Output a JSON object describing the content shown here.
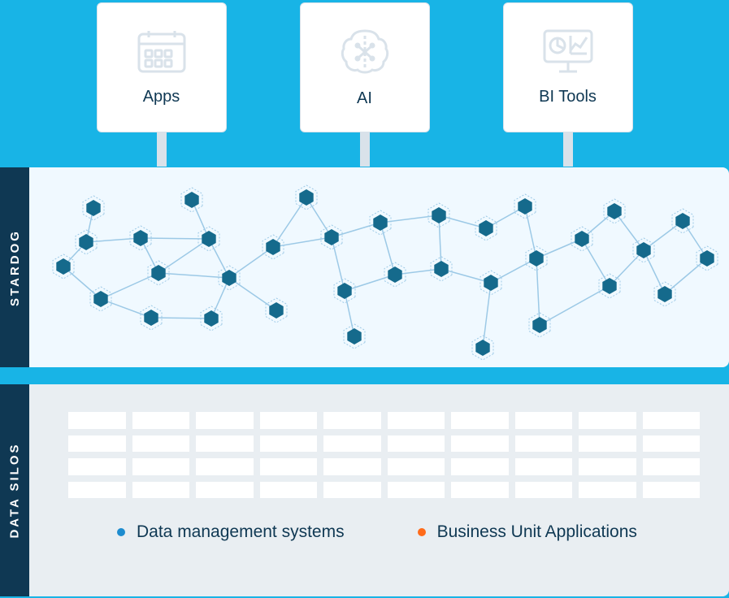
{
  "cards": {
    "apps": "Apps",
    "ai": "AI",
    "bi": "BI Tools"
  },
  "bands": {
    "stardog": "STARDOG",
    "silos": "DATA SILOS"
  },
  "legend": {
    "dms": "Data management systems",
    "bua": "Business Unit Applications"
  },
  "colors": {
    "bg": "#18b4e6",
    "dark": "#0f3853",
    "accent_blue": "#1d8ccf",
    "accent_orange": "#ff6b1a"
  },
  "graph_nodes": [
    [
      28,
      110
    ],
    [
      56,
      80
    ],
    [
      65,
      38
    ],
    [
      74,
      150
    ],
    [
      123,
      75
    ],
    [
      136,
      173
    ],
    [
      145,
      118
    ],
    [
      186,
      28
    ],
    [
      207,
      76
    ],
    [
      210,
      174
    ],
    [
      232,
      124
    ],
    [
      286,
      86
    ],
    [
      290,
      164
    ],
    [
      327,
      25
    ],
    [
      358,
      74
    ],
    [
      374,
      140
    ],
    [
      386,
      196
    ],
    [
      418,
      56
    ],
    [
      436,
      120
    ],
    [
      490,
      47
    ],
    [
      493,
      113
    ],
    [
      554,
      130
    ],
    [
      548,
      63
    ],
    [
      544,
      210
    ],
    [
      596,
      36
    ],
    [
      610,
      100
    ],
    [
      614,
      182
    ],
    [
      666,
      76
    ],
    [
      700,
      134
    ],
    [
      706,
      42
    ],
    [
      742,
      90
    ],
    [
      768,
      144
    ],
    [
      790,
      54
    ],
    [
      820,
      100
    ]
  ],
  "graph_edges": [
    [
      0,
      1
    ],
    [
      1,
      2
    ],
    [
      1,
      4
    ],
    [
      0,
      3
    ],
    [
      3,
      5
    ],
    [
      3,
      6
    ],
    [
      4,
      6
    ],
    [
      4,
      8
    ],
    [
      6,
      8
    ],
    [
      7,
      8
    ],
    [
      8,
      10
    ],
    [
      6,
      10
    ],
    [
      5,
      9
    ],
    [
      9,
      10
    ],
    [
      10,
      12
    ],
    [
      10,
      11
    ],
    [
      11,
      13
    ],
    [
      11,
      14
    ],
    [
      13,
      14
    ],
    [
      14,
      15
    ],
    [
      15,
      16
    ],
    [
      14,
      17
    ],
    [
      15,
      18
    ],
    [
      17,
      18
    ],
    [
      17,
      19
    ],
    [
      18,
      20
    ],
    [
      19,
      20
    ],
    [
      19,
      22
    ],
    [
      20,
      21
    ],
    [
      21,
      23
    ],
    [
      21,
      25
    ],
    [
      22,
      24
    ],
    [
      24,
      25
    ],
    [
      25,
      26
    ],
    [
      25,
      27
    ],
    [
      26,
      28
    ],
    [
      27,
      28
    ],
    [
      27,
      29
    ],
    [
      29,
      30
    ],
    [
      28,
      30
    ],
    [
      30,
      31
    ],
    [
      30,
      32
    ],
    [
      32,
      33
    ],
    [
      31,
      33
    ]
  ]
}
